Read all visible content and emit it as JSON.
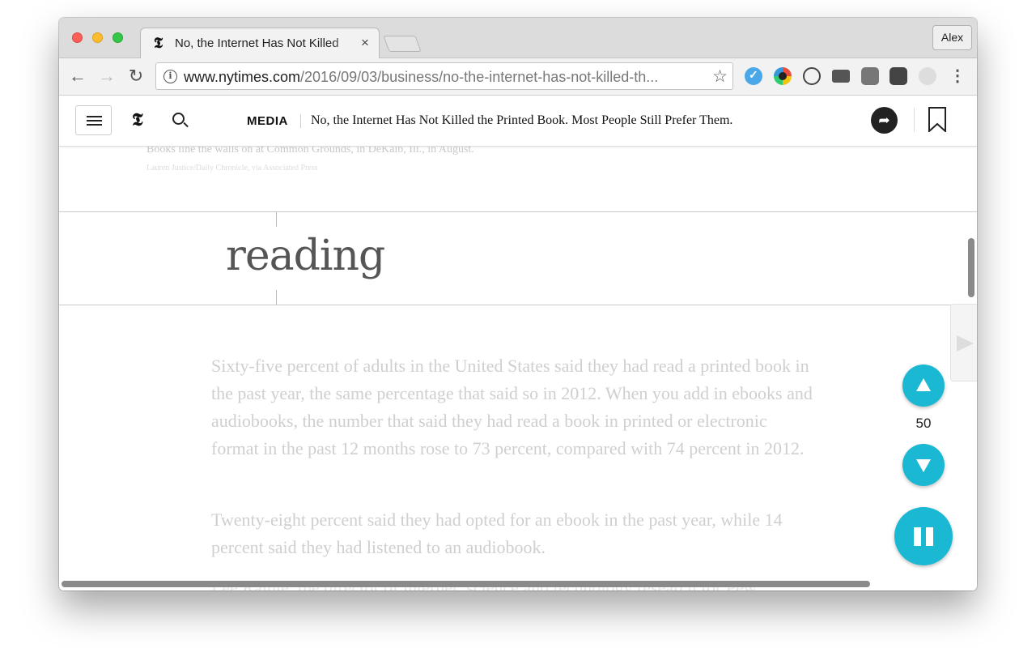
{
  "browser": {
    "tab_title": "No, the Internet Has Not Killed",
    "tab_close": "×",
    "profile_name": "Alex",
    "url_host": "www.nytimes.com",
    "url_path": "/2016/09/03/business/no-the-internet-has-not-killed-th...",
    "back_glyph": "←",
    "forward_glyph": "→",
    "reload_glyph": "↻",
    "star_glyph": "☆",
    "menu_glyph": "⋮"
  },
  "header": {
    "logo": "𝕿",
    "section": "MEDIA",
    "headline": "No, the Internet Has Not Killed the Printed Book. Most People Still Prefer Them."
  },
  "article": {
    "caption": "Books line the walls on at Common Grounds, in DeKalb, Ill., in August.",
    "credit": "Lauren Justice/Daily Chronicle, via Associated Press",
    "paragraphs": [
      "Sixty-five percent of adults in the United States said they had read a printed book in the past year, the same percentage that said so in 2012. When you add in ebooks and audiobooks, the number that said they had read a book in printed or electronic format in the past 12 months rose to 73 percent, compared with 74 percent in 2012.",
      "Twenty-eight percent said they had opted for an ebook in the past year, while 14 percent said they had listened to an audiobook.",
      "Lee Rainie, the director of internet, science and technology research for Pew"
    ]
  },
  "reader": {
    "current_word": "reading",
    "speed": "50"
  },
  "colors": {
    "accent": "#1ab8d2"
  }
}
